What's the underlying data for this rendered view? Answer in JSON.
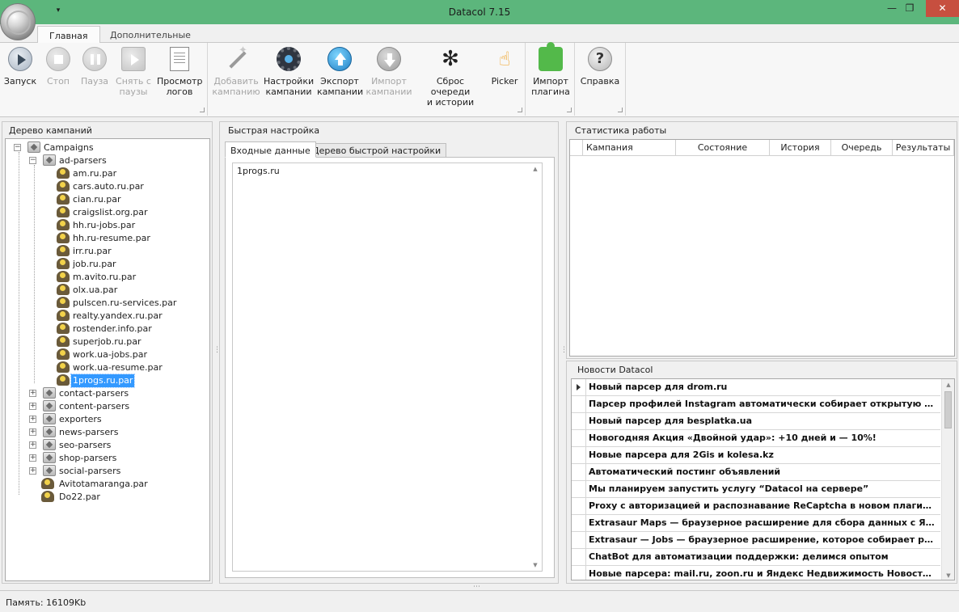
{
  "window": {
    "title": "Datacol 7.15",
    "qa_glyph": "▾",
    "min_glyph": "—",
    "max_glyph": "❐",
    "close_glyph": "✕"
  },
  "ribbon_tabs": [
    "Главная",
    "Дополнительные"
  ],
  "ribbon": {
    "start": "Запуск",
    "stop": "Стоп",
    "pause": "Пауза",
    "unpause_1": "Снять с",
    "unpause_2": "паузы",
    "view_logs_1": "Просмотр",
    "view_logs_2": "логов",
    "add_campaign_1": "Добавить",
    "add_campaign_2": "кампанию",
    "campaign_settings_1": "Настройки",
    "campaign_settings_2": "кампании",
    "export_1": "Экспорт",
    "export_2": "кампании",
    "import_1": "Импорт",
    "import_2": "кампании",
    "reset_1": "Сброс очереди",
    "reset_2": "и истории",
    "picker": "Picker",
    "plugin_import_1": "Импорт",
    "plugin_import_2": "плагина",
    "help": "Справка"
  },
  "tree_panel": {
    "title": "Дерево кампаний",
    "root": "Campaigns",
    "ad_folder": "ad-parsers",
    "ad_items": [
      "am.ru.par",
      "cars.auto.ru.par",
      "cian.ru.par",
      "craigslist.org.par",
      "hh.ru-jobs.par",
      "hh.ru-resume.par",
      "irr.ru.par",
      "job.ru.par",
      "m.avito.ru.par",
      "olx.ua.par",
      "pulscen.ru-services.par",
      "realty.yandex.ru.par",
      "rostender.info.par",
      "superjob.ru.par",
      "work.ua-jobs.par",
      "work.ua-resume.par",
      "1progs.ru.par"
    ],
    "folders": [
      "contact-parsers",
      "content-parsers",
      "exporters",
      "news-parsers",
      "seo-parsers",
      "shop-parsers",
      "social-parsers"
    ],
    "files": [
      "Avitotamaranga.par",
      "Do22.par"
    ],
    "selected": "1progs.ru.par"
  },
  "quick_setup": {
    "title": "Быстрая настройка",
    "tabs": [
      "Входные данные",
      "Дерево быстрой настройки"
    ],
    "input_value": "1progs.ru"
  },
  "stats": {
    "title": "Статистика работы",
    "columns": [
      "Кампания",
      "Состояние",
      "История",
      "Очередь",
      "Результаты"
    ]
  },
  "news": {
    "title": "Новости Datacol",
    "items": [
      "Новый парсер для drom.ru",
      "Парсер профилей Instagram автоматически собирает открытую информацию",
      "Новый парсер для besplatka.ua",
      "Новогодняя Акция «Двойной удар»: +10 дней и — 10%!",
      "Новые парсера для 2Gis и kolesa.kz",
      "Автоматический постинг объявлений",
      "Мы планируем запустить услугу “Datacol на сервере”",
      "Proxy с авторизацией и распознавание ReCaptcha в новом плагине Chrome",
      "Extrasaur Maps — браузерное расширение для сбора данных с Яндекс Карт",
      "Extrasaur — Jobs — браузерное расширение, которое собирает резюме и вакансии",
      "ChatBot для автоматизации поддержки: делимся опытом",
      "Новые парсера: mail.ru, zoon.ru и Яндекс Недвижимость Новостройки"
    ]
  },
  "status": {
    "memory": "Память: 16109Kb"
  }
}
